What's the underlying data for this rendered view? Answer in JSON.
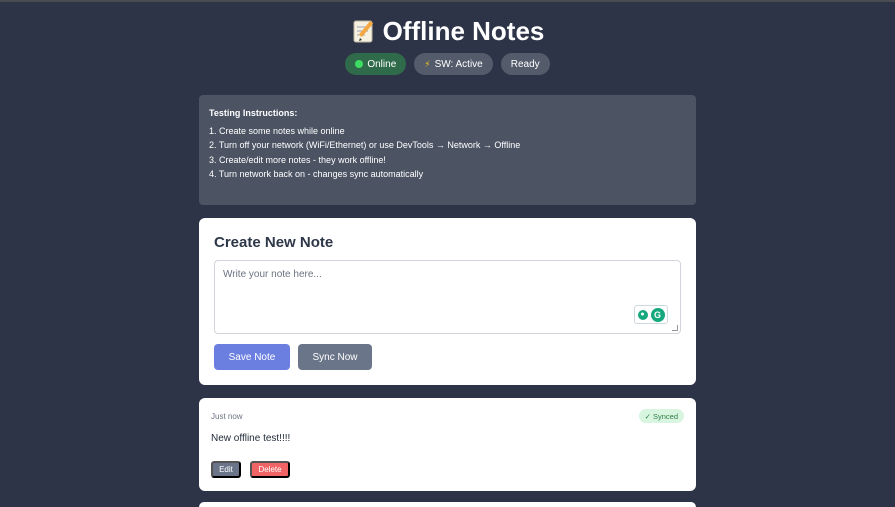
{
  "app": {
    "title": "Offline Notes",
    "title_icon": "memo-icon"
  },
  "status": {
    "online_label": "Online",
    "sw_label": "SW: Active",
    "ready_label": "Ready"
  },
  "instructions": {
    "heading": "Testing Instructions:",
    "steps": [
      "1. Create some notes while online",
      "2. Turn off your network (WiFi/Ethernet) or use DevTools → Network → Offline",
      "3. Create/edit more notes - they work offline!",
      "4. Turn network back on - changes sync automatically"
    ]
  },
  "create": {
    "title": "Create New Note",
    "placeholder": "Write your note here...",
    "save_label": "Save Note",
    "sync_label": "Sync Now"
  },
  "notes": [
    {
      "time": "Just now",
      "status": "✓ Synced",
      "text": "New offline test!!!!",
      "edit_label": "Edit",
      "delete_label": "Delete"
    }
  ],
  "colors": {
    "background": "#2d3448",
    "accent": "#6b7fe0",
    "danger": "#f16466",
    "online": "#2f6b4a",
    "synced": "#d8f5df"
  }
}
